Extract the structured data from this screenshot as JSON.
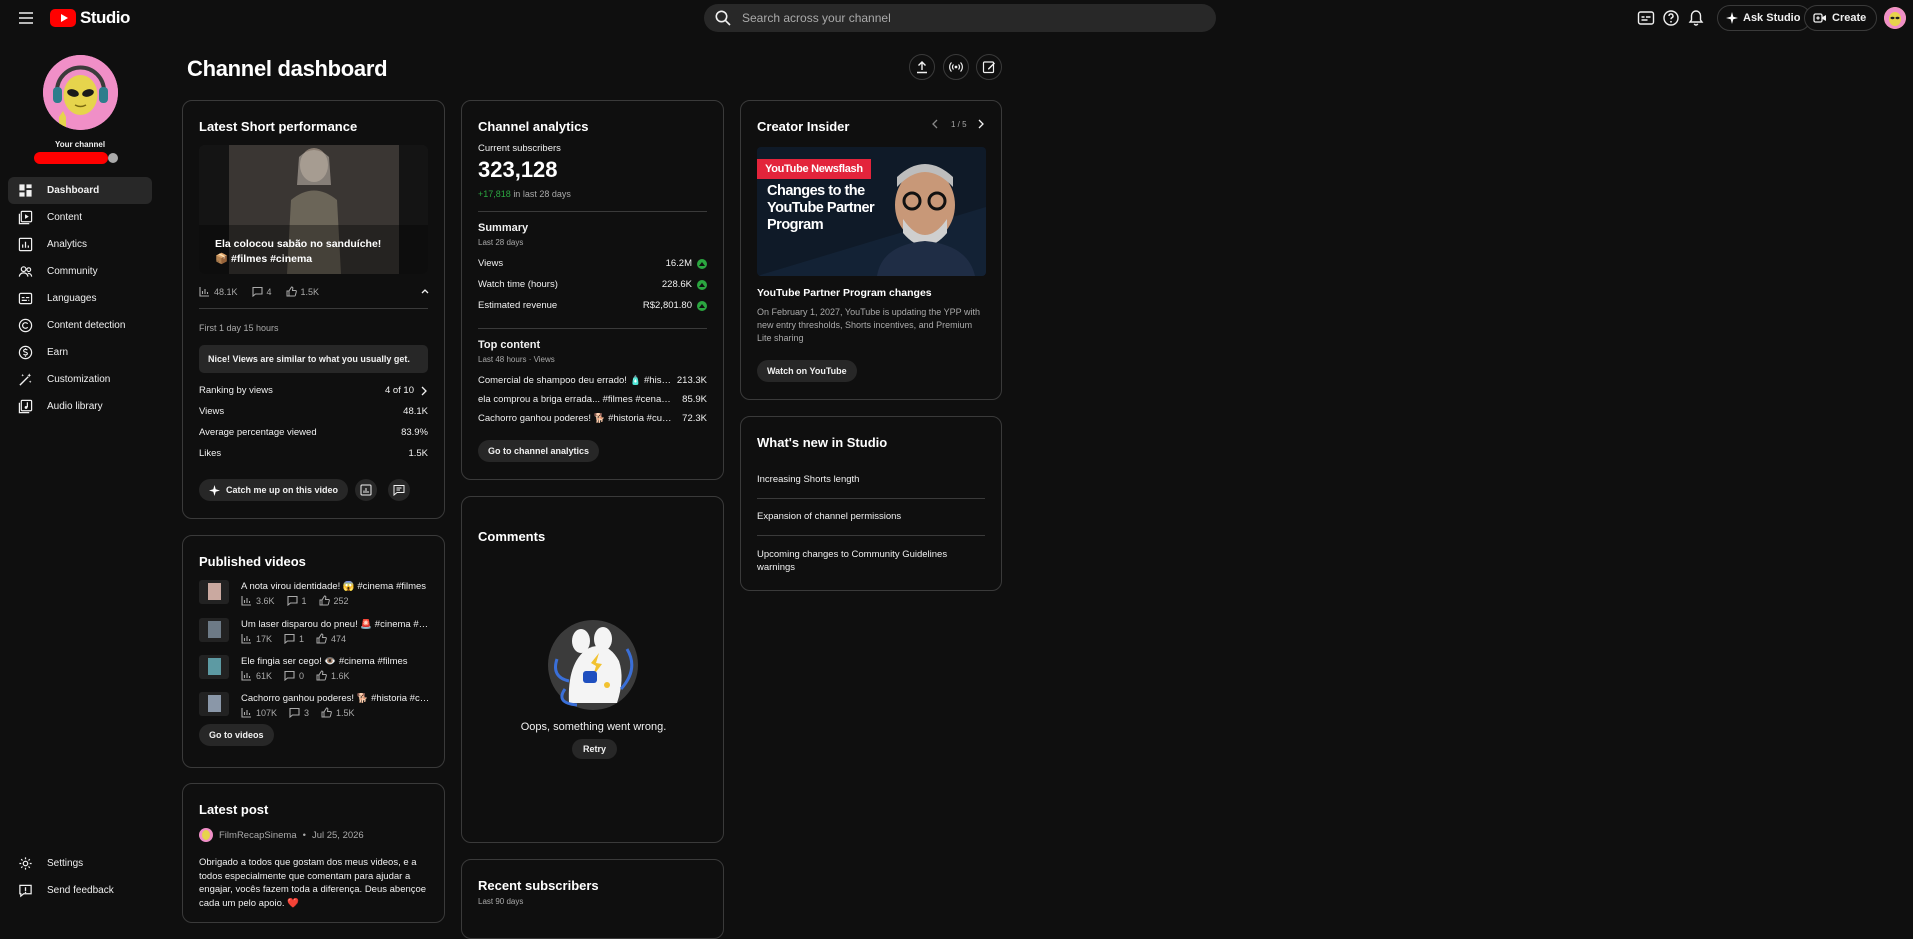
{
  "app": {
    "logo_text": "Studio"
  },
  "search": {
    "placeholder": "Search across your channel"
  },
  "topbar": {
    "ask_studio": "Ask Studio",
    "create": "Create"
  },
  "sidebar": {
    "your_channel": "Your channel",
    "items": [
      {
        "label": "Dashboard",
        "icon": "dashboard-icon",
        "active": true
      },
      {
        "label": "Content",
        "icon": "content-icon"
      },
      {
        "label": "Analytics",
        "icon": "analytics-icon"
      },
      {
        "label": "Community",
        "icon": "community-icon"
      },
      {
        "label": "Languages",
        "icon": "languages-icon"
      },
      {
        "label": "Content detection",
        "icon": "copyright-icon"
      },
      {
        "label": "Earn",
        "icon": "earn-icon"
      },
      {
        "label": "Customization",
        "icon": "customization-icon"
      },
      {
        "label": "Audio library",
        "icon": "audio-library-icon"
      }
    ],
    "bottom": [
      {
        "label": "Settings",
        "icon": "gear-icon"
      },
      {
        "label": "Send feedback",
        "icon": "feedback-icon"
      }
    ]
  },
  "page": {
    "title": "Channel dashboard"
  },
  "latest_short": {
    "title": "Latest Short performance",
    "video_caption": "Ela colocou sabão no sanduíche! 📦 #filmes #cinema",
    "views": "48.1K",
    "comments": "4",
    "likes": "1.5K",
    "period": "First 1 day 15 hours",
    "notice": "Nice! Views are similar to what you usually get.",
    "ranking_label": "Ranking by views",
    "ranking_value": "4 of 10",
    "views_label": "Views",
    "views_value": "48.1K",
    "apv_label": "Average percentage viewed",
    "apv_value": "83.9%",
    "likes_label": "Likes",
    "likes_value": "1.5K",
    "catch_up": "Catch me up on this video"
  },
  "published": {
    "title": "Published videos",
    "videos": [
      {
        "title": "A nota virou identidade! 😱 #cinema #filmes",
        "views": "3.6K",
        "comments": "1",
        "likes": "252"
      },
      {
        "title": "Um laser disparou do pneu! 🚨 #cinema #filmes",
        "views": "17K",
        "comments": "1",
        "likes": "474"
      },
      {
        "title": "Ele fingia ser cego! 👁️ #cinema #filmes",
        "views": "61K",
        "comments": "0",
        "likes": "1.6K"
      },
      {
        "title": "Cachorro ganhou poderes! 🐕 #historia #curiosidades",
        "views": "107K",
        "comments": "3",
        "likes": "1.5K"
      }
    ],
    "button": "Go to videos"
  },
  "latest_post": {
    "title": "Latest post",
    "author": "FilmRecapSinema",
    "date": "Jul 25, 2026",
    "text": "Obrigado a todos que gostam dos meus videos, e a todos especialmente que comentam para ajudar a engajar, vocês fazem toda a diferença. Deus abençoe cada um pelo apoio. ❤️"
  },
  "analytics": {
    "title": "Channel analytics",
    "subs_label": "Current subscribers",
    "subs_value": "323,128",
    "subs_delta": "+17,818",
    "subs_delta_suffix": "in last 28 days",
    "summary_title": "Summary",
    "summary_period": "Last 28 days",
    "metrics": [
      {
        "label": "Views",
        "value": "16.2M"
      },
      {
        "label": "Watch time (hours)",
        "value": "228.6K"
      },
      {
        "label": "Estimated revenue",
        "value": "R$2,801.80"
      }
    ],
    "top_title": "Top content",
    "top_period": "Last 48 hours · Views",
    "top_items": [
      {
        "title": "Comercial de shampoo deu errado! 🧴 #historia",
        "value": "213.3K"
      },
      {
        "title": "ela comprou a briga errada... #filmes #cenadefilme",
        "value": "85.9K"
      },
      {
        "title": "Cachorro ganhou poderes! 🐕 #historia #curiosidades",
        "value": "72.3K"
      }
    ],
    "button": "Go to channel analytics"
  },
  "comments": {
    "title": "Comments",
    "error": "Oops, something went wrong.",
    "retry": "Retry"
  },
  "recent_subs": {
    "title": "Recent subscribers",
    "period": "Last 90 days"
  },
  "insider": {
    "title": "Creator Insider",
    "page": "1 / 5",
    "banner_tag": "YouTube Newsflash",
    "banner_headline": "Changes to the YouTube Partner Program",
    "headline": "YouTube Partner Program changes",
    "body": "On February 1, 2027, YouTube is updating the YPP with new entry thresholds, Shorts incentives, and Premium Lite sharing",
    "button": "Watch on YouTube"
  },
  "whats_new": {
    "title": "What's new in Studio",
    "items": [
      "Increasing Shorts length",
      "Expansion of channel permissions",
      "Upcoming changes to Community Guidelines warnings"
    ]
  },
  "colors": {
    "accent_red": "#ff0000",
    "positive_green": "#2ba640",
    "card_border": "#3a3a3a",
    "background": "#0f0f0f"
  }
}
